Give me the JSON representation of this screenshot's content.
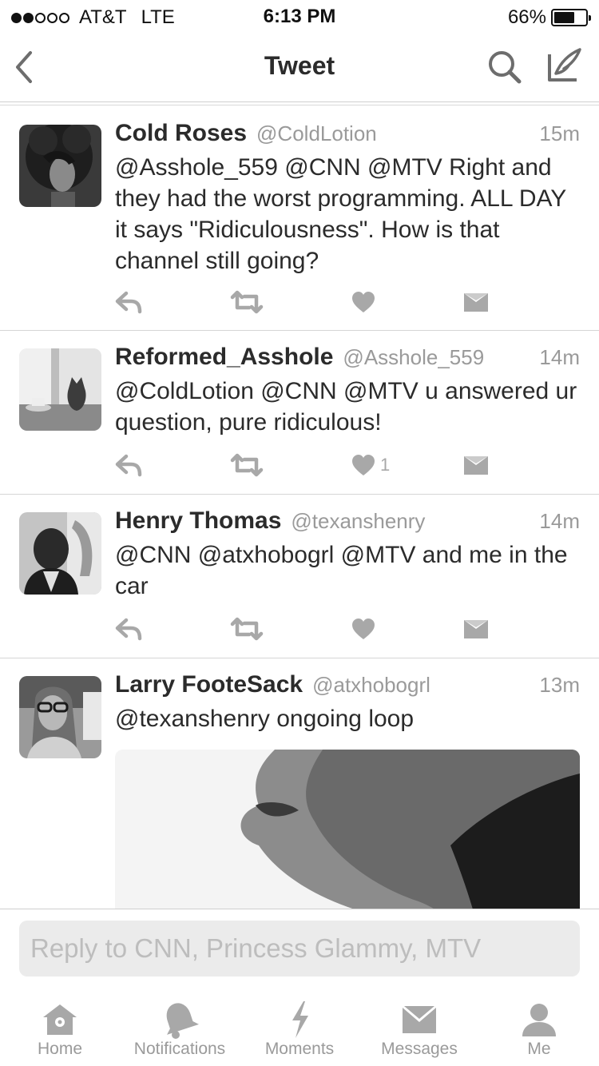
{
  "status_bar": {
    "carrier": "AT&T",
    "network": "LTE",
    "time": "6:13 PM",
    "battery": "66%",
    "battery_level": 0.66,
    "signal_bars": 2
  },
  "nav": {
    "title": "Tweet",
    "icons": [
      "back-chevron-icon",
      "search-icon",
      "compose-icon"
    ]
  },
  "tweets": [
    {
      "name": "Cold Roses",
      "handle": "@ColdLotion",
      "time": "15m",
      "text": "@Asshole_559 @CNN @MTV Right and they had the worst programming. ALL DAY it says \"Ridiculousness\".  How is that channel still going?",
      "likes": ""
    },
    {
      "name": "Reformed_Asshole",
      "handle": "@Asshole_559",
      "time": "14m",
      "text": "@ColdLotion @CNN @MTV u answered ur question, pure ridiculous!",
      "likes": "1"
    },
    {
      "name": "Henry Thomas",
      "handle": "@texanshenry",
      "time": "14m",
      "text": "@CNN @atxhobogrl @MTV and me in the car",
      "likes": ""
    },
    {
      "name": "Larry FooteSack",
      "handle": "@atxhobogrl",
      "time": "13m",
      "text": "@texanshenry ongoing loop",
      "likes": ""
    }
  ],
  "reply": {
    "placeholder": "Reply to CNN, Princess Glammy, MTV"
  },
  "tabs": [
    {
      "label": "Home",
      "icon": "home-icon"
    },
    {
      "label": "Notifications",
      "icon": "bell-icon"
    },
    {
      "label": "Moments",
      "icon": "lightning-icon"
    },
    {
      "label": "Messages",
      "icon": "envelope-icon"
    },
    {
      "label": "Me",
      "icon": "person-icon"
    }
  ],
  "colors": {
    "text": "#2b2b2b",
    "secondary": "#9a9a9a",
    "icon": "#a8a8a8",
    "divider": "#d6d6d6"
  }
}
